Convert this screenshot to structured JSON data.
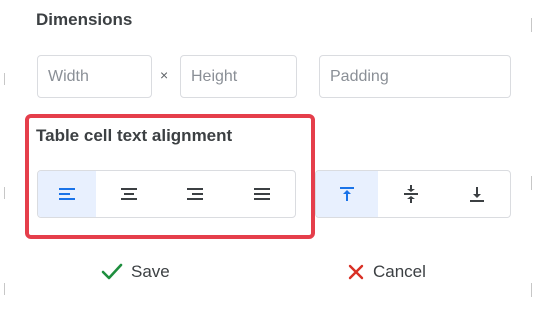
{
  "dimensions": {
    "title": "Dimensions",
    "width_placeholder": "Width",
    "times_symbol": "×",
    "height_placeholder": "Height",
    "padding_placeholder": "Padding"
  },
  "alignment": {
    "title": "Table cell text alignment",
    "horizontal": [
      {
        "name": "align-left",
        "active": true
      },
      {
        "name": "align-center",
        "active": false
      },
      {
        "name": "align-right",
        "active": false
      },
      {
        "name": "align-justify",
        "active": false
      }
    ],
    "vertical": [
      {
        "name": "align-top",
        "active": true
      },
      {
        "name": "align-middle",
        "active": false
      },
      {
        "name": "align-bottom",
        "active": false
      }
    ]
  },
  "actions": {
    "save_label": "Save",
    "cancel_label": "Cancel"
  },
  "colors": {
    "accent": "#1a73e8",
    "active_background": "#e8f0fe",
    "highlight": "#e53e4b",
    "save": "#1e8e3e",
    "cancel": "#d93025"
  },
  "icons": {
    "save": "checkmark-icon",
    "cancel": "x-icon"
  }
}
